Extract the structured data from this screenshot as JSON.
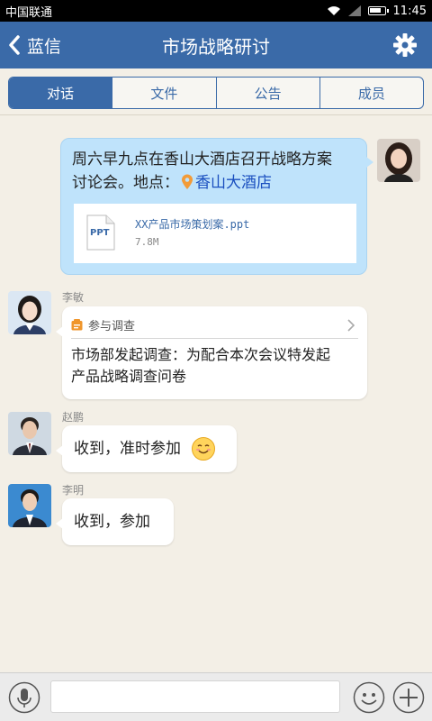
{
  "status_bar": {
    "carrier": "中国联通",
    "time": "11:45",
    "battery_level": 0.8
  },
  "nav": {
    "back_label": "蓝信",
    "title": "市场战略研讨"
  },
  "tabs": [
    {
      "label": "对话",
      "active": true
    },
    {
      "label": "文件",
      "active": false
    },
    {
      "label": "公告",
      "active": false
    },
    {
      "label": "成员",
      "active": false
    }
  ],
  "messages": {
    "m1": {
      "text_line1": "周六早九点在香山大酒店召开战略方案",
      "text_line2_prefix": "讨论会。地点：",
      "location": "香山大酒店",
      "file": {
        "type_label": "PPT",
        "name": "XX产品市场策划案.ppt",
        "size": "7.8M"
      }
    },
    "m2": {
      "sender": "李敏",
      "card_title": "参与调查",
      "text_line1": "市场部发起调查：为配合本次会议特发起",
      "text_line2": "产品战略调查问卷"
    },
    "m3": {
      "sender": "赵鹏",
      "text": "收到，准时参加"
    },
    "m4": {
      "sender": "李明",
      "text": "收到，参加"
    }
  },
  "input": {
    "placeholder": "",
    "value": ""
  },
  "colors": {
    "nav": "#3a6aa8",
    "background": "#f3efe6",
    "self_bubble": "#bfe3fb",
    "link": "#1a4fbf",
    "pin": "#f29b38"
  },
  "icons": [
    "back-icon",
    "gear-icon",
    "location-pin-icon",
    "ppt-file-icon",
    "survey-icon",
    "chevron-right-icon",
    "smile-emoji-icon",
    "mic-icon",
    "emoji-icon",
    "plus-icon"
  ]
}
